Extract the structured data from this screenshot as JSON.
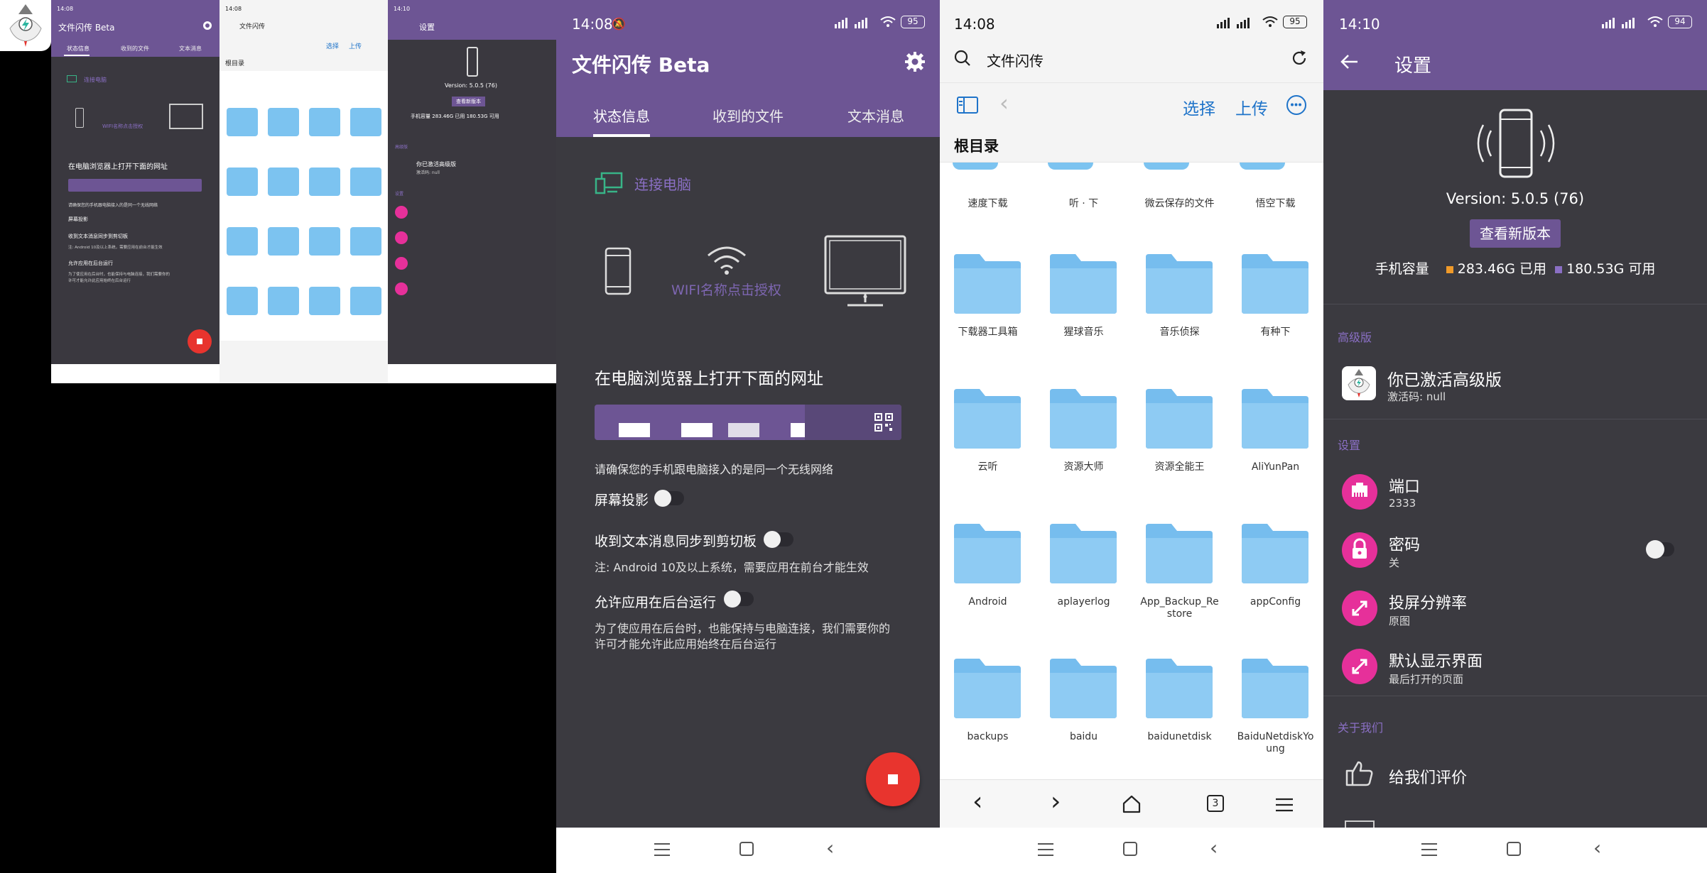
{
  "status_bar": {
    "time_1408": "14:08",
    "time_1410": "14:10",
    "battery_95": "95",
    "battery_94": "94"
  },
  "app": {
    "title": "文件闪传 Beta",
    "tabs": [
      "状态信息",
      "收到的文件",
      "文本消息"
    ],
    "connect_pc": "连接电脑",
    "wifi_hint": "WIFI名称点击授权",
    "open_url": "在电脑浏览器上打开下面的网址",
    "same_wifi": "请确保您的手机跟电脑接入的是同一个无线网络",
    "screen_cast": "屏幕投影",
    "sync_clipboard": "收到文本消息同步到剪切板",
    "clipboard_note": "注: Android 10及以上系统，需要应用在前台才能生效",
    "allow_background": "允许应用在后台运行",
    "background_note_1": "为了使应用在后台时，也能保持与电脑连接，我们需要你的",
    "background_note_2": "许可才能允许此应用始终在后台运行"
  },
  "files": {
    "search_text": "文件闪传",
    "select": "选择",
    "upload": "上传",
    "root": "根目录",
    "top_row": [
      "速度下载",
      "听 · 下",
      "微云保存的文件",
      "悟空下载"
    ],
    "folders": [
      [
        "下载器工具箱",
        "猩球音乐",
        "音乐侦探",
        "有种下"
      ],
      [
        "云听",
        "资源大师",
        "资源全能王",
        "AliYunPan"
      ],
      [
        "Android",
        "aplayerlog",
        "App_Backup_Re\nstore",
        "appConfig"
      ],
      [
        "backups",
        "baidu",
        "baidunetdisk",
        "BaiduNetdiskYo\nung"
      ]
    ],
    "tab_count": "3"
  },
  "settings": {
    "title": "设置",
    "version": "Version: 5.0.5 (76)",
    "check_update": "查看新版本",
    "storage_label": "手机容量",
    "used": "283.46G 已用",
    "free": "180.53G 可用",
    "section_pro": "高级版",
    "pro_title": "你已激活高级版",
    "pro_sub": "激活码: null",
    "section_settings": "设置",
    "port_title": "端口",
    "port_value": "2333",
    "password_title": "密码",
    "password_value": "关",
    "resolution_title": "投屏分辨率",
    "resolution_value": "原图",
    "default_view_title": "默认显示界面",
    "default_view_value": "最后打开的页面",
    "section_about": "关于我们",
    "rate_us": "给我们评价",
    "small_used": "283.46G 已用",
    "small_free": "180.53G 可用"
  },
  "colors": {
    "purple": "#6d5594",
    "dark_bg": "#3b3a40",
    "accent_pink": "#e6309a",
    "fab_red": "#e8342e",
    "folder_blue": "#7cc3f0",
    "link_blue": "#1e73c9",
    "green_icon": "#38b487",
    "used_orange": "#f09a2a",
    "free_purple": "#8a6fc4"
  }
}
